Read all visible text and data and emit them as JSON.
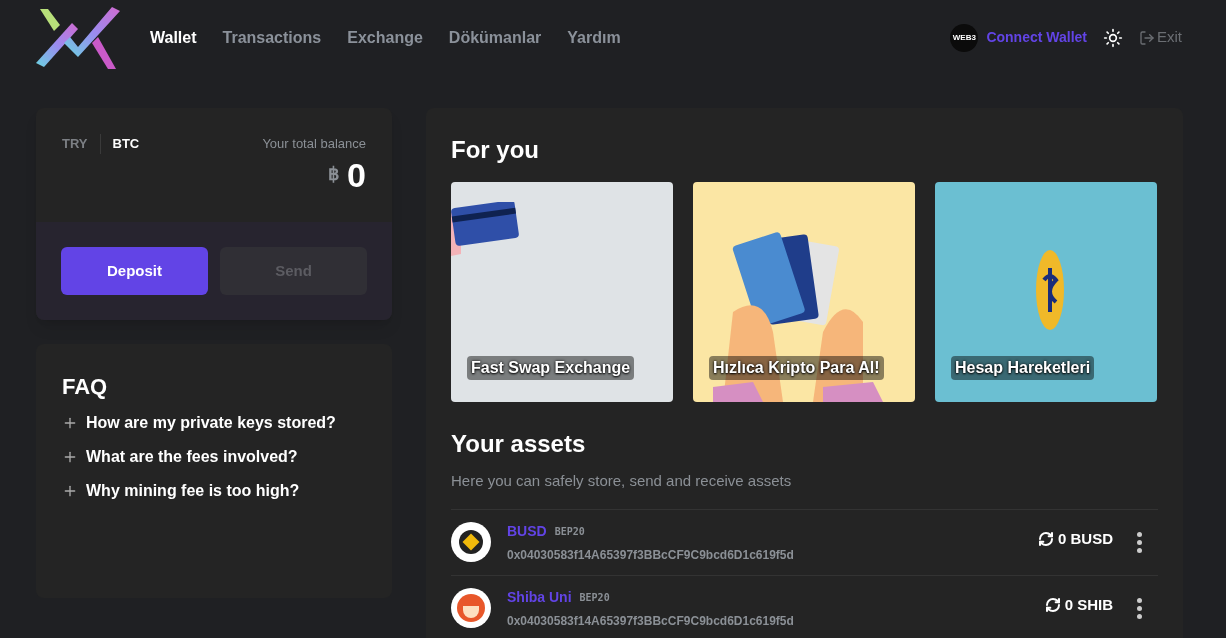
{
  "nav": {
    "items": [
      {
        "label": "Wallet",
        "selected": true
      },
      {
        "label": "Transactions",
        "selected": false
      },
      {
        "label": "Exchange",
        "selected": false
      },
      {
        "label": "Dökümanlar",
        "selected": false
      },
      {
        "label": "Yardım",
        "selected": false
      }
    ],
    "web3_badge": "WEB3",
    "connect": "Connect Wallet",
    "exit": "Exit"
  },
  "balance": {
    "currencies": [
      {
        "label": "TRY",
        "selected": false
      },
      {
        "label": "BTC",
        "selected": true
      }
    ],
    "caption": "Your total balance",
    "symbol": "฿",
    "amount": "0",
    "buttons": [
      {
        "label": "Deposit",
        "disabled": false
      },
      {
        "label": "Send",
        "disabled": true
      }
    ]
  },
  "faq": {
    "title": "FAQ",
    "items": [
      {
        "question": "How are my private keys stored?",
        "expanded": false
      },
      {
        "question": "What are the fees involved?",
        "expanded": false
      },
      {
        "question": "Why mining fee is too high?",
        "expanded": false
      }
    ]
  },
  "for_you": {
    "title": "For you",
    "cards": [
      {
        "kind": "card",
        "label": "Fast Swap Exchange",
        "color": "#dfe3e6"
      },
      {
        "kind": "cards",
        "label": "Hızlıca Kripto Para Al!",
        "color": "#fbe6a4"
      },
      {
        "kind": "coin",
        "label": "Hesap Hareketleri",
        "color": "#6bbfd2"
      }
    ]
  },
  "assets": {
    "title": "Your assets",
    "subtitle": "Here you can safely store, send and receive assets",
    "rows": [
      {
        "kind": "busd",
        "name": "BUSD",
        "network": "BEP20",
        "address": "0x04030583f14A65397f3BBcCF9C9bcd6D1c619f5d",
        "balance": "0 BUSD"
      },
      {
        "kind": "shib",
        "name": "Shiba Uni",
        "network": "BEP20",
        "address": "0x04030583f14A65397f3BBcCF9C9bcd6D1c619f5d",
        "balance": "0 SHIB"
      }
    ]
  }
}
